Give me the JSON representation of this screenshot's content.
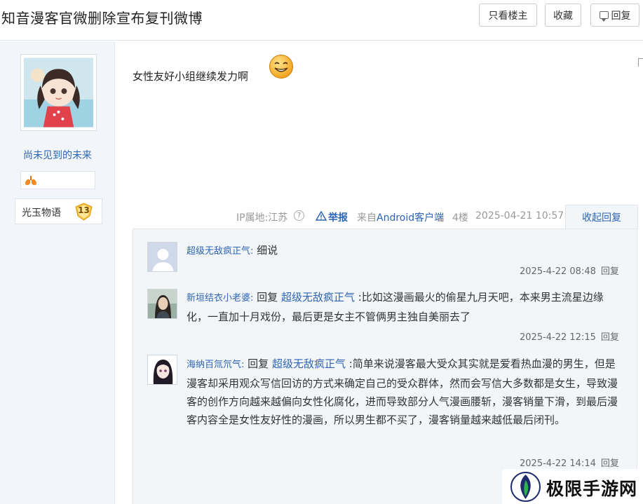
{
  "header": {
    "title": "知音漫客官微删除宣布复刊微博",
    "only_op_label": "只看楼主",
    "favorite_label": "收藏",
    "reply_label": "回复"
  },
  "author": {
    "name": "尚未见到的未来",
    "forum_name": "光玉物语",
    "level": "13"
  },
  "post": {
    "content": "女性友好小组继续发力啊",
    "ip_location": "IP属地:江苏",
    "report_label": "举报",
    "from_prefix": "来自",
    "client": "Android客户端",
    "floor": "4楼",
    "time": "2025-04-21 10:57",
    "collapse_label": "收起回复"
  },
  "replies": [
    {
      "user": "超级无敌疯正气:",
      "text": " 细说",
      "time": "2025-4-22 08:48",
      "reply_label": "回复"
    },
    {
      "user": "新垣结衣小老婆:",
      "prefix": " 回复 ",
      "target": "超级无敌疯正气",
      "text": " :比如这漫画最火的偷星九月天吧，本来男主流星边缘化，一直加十月戏份，最后更是女主不管俩男主独自美丽去了",
      "time": "2025-4-22 12:15",
      "reply_label": "回复"
    },
    {
      "user": "海纳百氚氘气:",
      "prefix": " 回复 ",
      "target": "超级无敌疯正气",
      "text": " :简单来说漫客最大受众其实就是爱看热血漫的男生，但是漫客却采用观众写信回访的方式来确定自己的受众群体，然而会写信大多数都是女生，导致漫客的创作方向越来越偏向女性化腐化，进而导致部分人气漫画腰斩，漫客销量下滑，到最后漫客内容全是女性友好性的漫画，所以男生都不买了，漫客销量越来越低最后闭刊。",
      "time": "2025-4-22 14:14",
      "reply_label": "回复"
    }
  ],
  "watermark": {
    "text": "极限手游网"
  },
  "icons": {
    "reply": "speech-bubble-icon",
    "help": "question-circle-icon",
    "report": "warning-triangle-icon",
    "smiley": "smiley-emoticon-icon",
    "lung": "lung-badge-icon",
    "level": "shield-badge-icon"
  },
  "colors": {
    "link_blue": "#2d64b3",
    "panel_bg": "#f3f6f9",
    "level_badge": "#f5c342"
  }
}
